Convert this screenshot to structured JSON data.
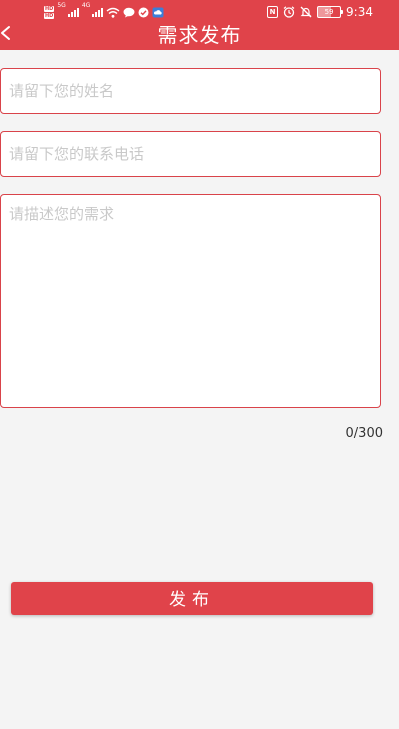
{
  "status_bar": {
    "hd_1": "HD",
    "hd_2": "HD",
    "network_1": "5G",
    "network_2": "4G",
    "nfc": "N",
    "battery": "59",
    "time": "9:34"
  },
  "header": {
    "title": "需求发布",
    "back_icon": "chevron-left-icon",
    "background_color": "#e0434a"
  },
  "form": {
    "name_placeholder": "请留下您的姓名",
    "name_value": "",
    "phone_placeholder": "请留下您的联系电话",
    "phone_value": "",
    "description_placeholder": "请描述您的需求",
    "description_value": "",
    "counter": "0/300",
    "submit_label": "发布"
  }
}
